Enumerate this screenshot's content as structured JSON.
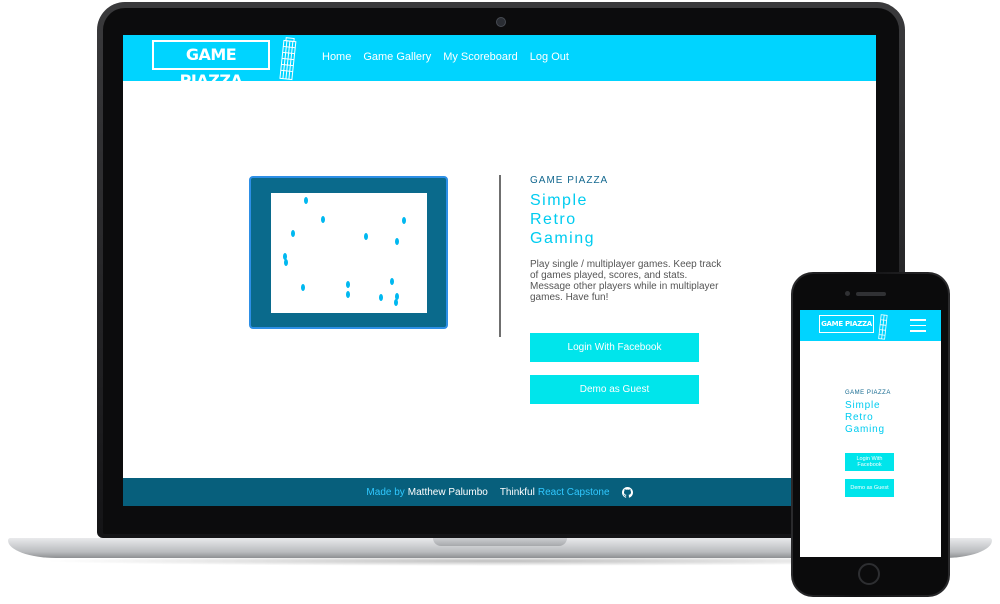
{
  "app": {
    "logo_text": "GAME PIAZZA",
    "brand_color": "#00d4ff",
    "accent_color": "#00e5eb",
    "footer_color": "#075f7c"
  },
  "nav": {
    "items": [
      "Home",
      "Game Gallery",
      "My Scoreboard",
      "Log Out"
    ]
  },
  "hero": {
    "brand_small": "GAME PIAZZA",
    "headline": [
      "Simple",
      "Retro",
      "Gaming"
    ],
    "description": "Play single / multiplayer games. Keep track of games played, scores, and stats. Message other players while in multiplayer games. Have fun!",
    "buttons": {
      "facebook": "Login With Facebook",
      "guest": "Demo as Guest"
    }
  },
  "footer": {
    "made_by": "Made by",
    "author": "Matthew Palumbo",
    "company": "Thinkful",
    "project": "React Capstone",
    "github_icon": "github-icon"
  },
  "mobile": {
    "logo_text": "GAME PIAZZA",
    "menu_icon": "hamburger-menu-icon",
    "brand_small": "GAME PIAZZA",
    "headline": [
      "Simple",
      "Retro",
      "Gaming"
    ],
    "buttons": {
      "facebook": "Login With Facebook",
      "guest": "Demo as Guest"
    }
  }
}
